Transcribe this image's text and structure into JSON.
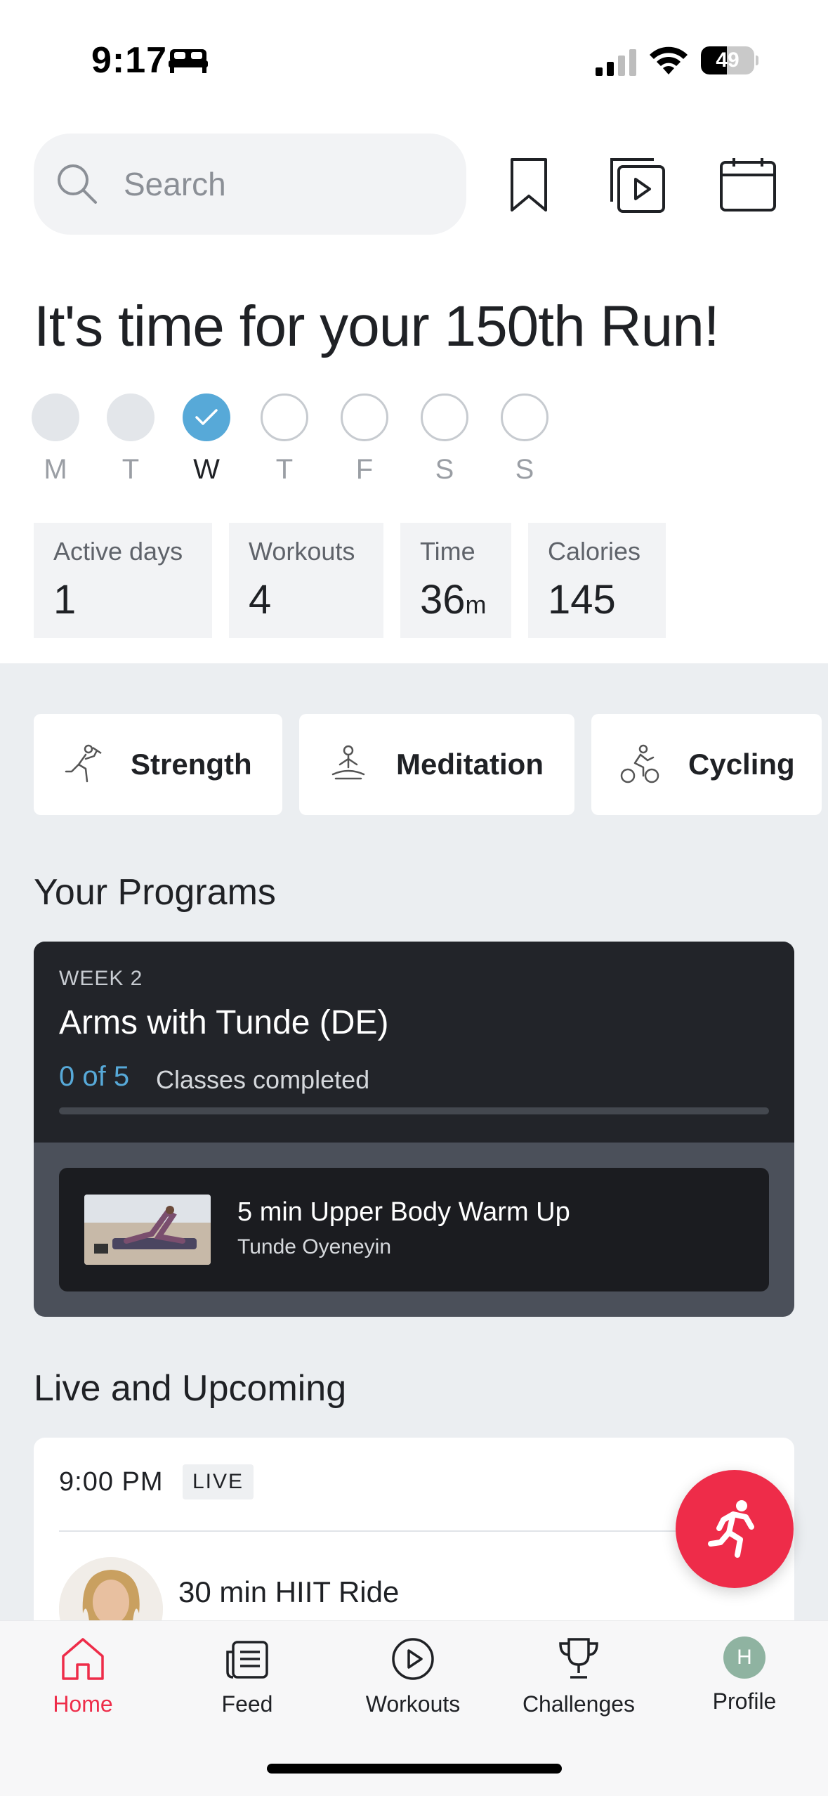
{
  "status_bar": {
    "time": "9:17",
    "battery": "49",
    "battery_level": 0.49,
    "icons": [
      "bed-icon",
      "signal-icon",
      "wifi-icon",
      "battery-icon"
    ]
  },
  "header": {
    "search_placeholder": "Search",
    "icons": [
      "search-icon",
      "bookmark-icon",
      "video-library-icon",
      "calendar-icon"
    ]
  },
  "greeting": "It's time for your 150th Run!",
  "week": {
    "days": [
      {
        "label": "M",
        "state": "done"
      },
      {
        "label": "T",
        "state": "done"
      },
      {
        "label": "W",
        "state": "today"
      },
      {
        "label": "T",
        "state": "todo"
      },
      {
        "label": "F",
        "state": "todo"
      },
      {
        "label": "S",
        "state": "todo"
      },
      {
        "label": "S",
        "state": "todo"
      }
    ]
  },
  "stats": {
    "active_days": {
      "label": "Active days",
      "value": "1"
    },
    "workouts": {
      "label": "Workouts",
      "value": "4"
    },
    "time": {
      "label": "Time",
      "value": "36",
      "unit": "m"
    },
    "calories": {
      "label": "Calories",
      "value": "145"
    }
  },
  "categories": [
    {
      "label": "Strength",
      "icon": "strength-icon"
    },
    {
      "label": "Meditation",
      "icon": "meditation-icon"
    },
    {
      "label": "Cycling",
      "icon": "cycling-icon"
    }
  ],
  "programs": {
    "title": "Your Programs",
    "card": {
      "week": "WEEK 2",
      "name": "Arms with Tunde (DE)",
      "progress": "0 of 5",
      "progress_label": "Classes completed",
      "progress_fraction": 0,
      "class_title": "5 min Upper Body Warm Up",
      "class_instructor": "Tunde Oyeneyin"
    }
  },
  "live": {
    "title": "Live and Upcoming",
    "card": {
      "time": "9:00 PM",
      "badge": "LIVE",
      "class_title": "30 min HIIT Ride"
    }
  },
  "fab": {
    "icon": "running-person-icon"
  },
  "tabbar": {
    "tabs": [
      {
        "label": "Home",
        "icon": "home-icon",
        "active": true
      },
      {
        "label": "Feed",
        "icon": "feed-icon",
        "active": false
      },
      {
        "label": "Workouts",
        "icon": "play-circle-icon",
        "active": false
      },
      {
        "label": "Challenges",
        "icon": "trophy-icon",
        "active": false
      },
      {
        "label": "Profile",
        "icon": "avatar",
        "active": false,
        "avatar_initial": "H"
      }
    ]
  },
  "colors": {
    "accent_red": "#ee2c49",
    "accent_blue": "#57a9d8",
    "section_bg": "#ebeef1",
    "card_dark": "#222429"
  }
}
